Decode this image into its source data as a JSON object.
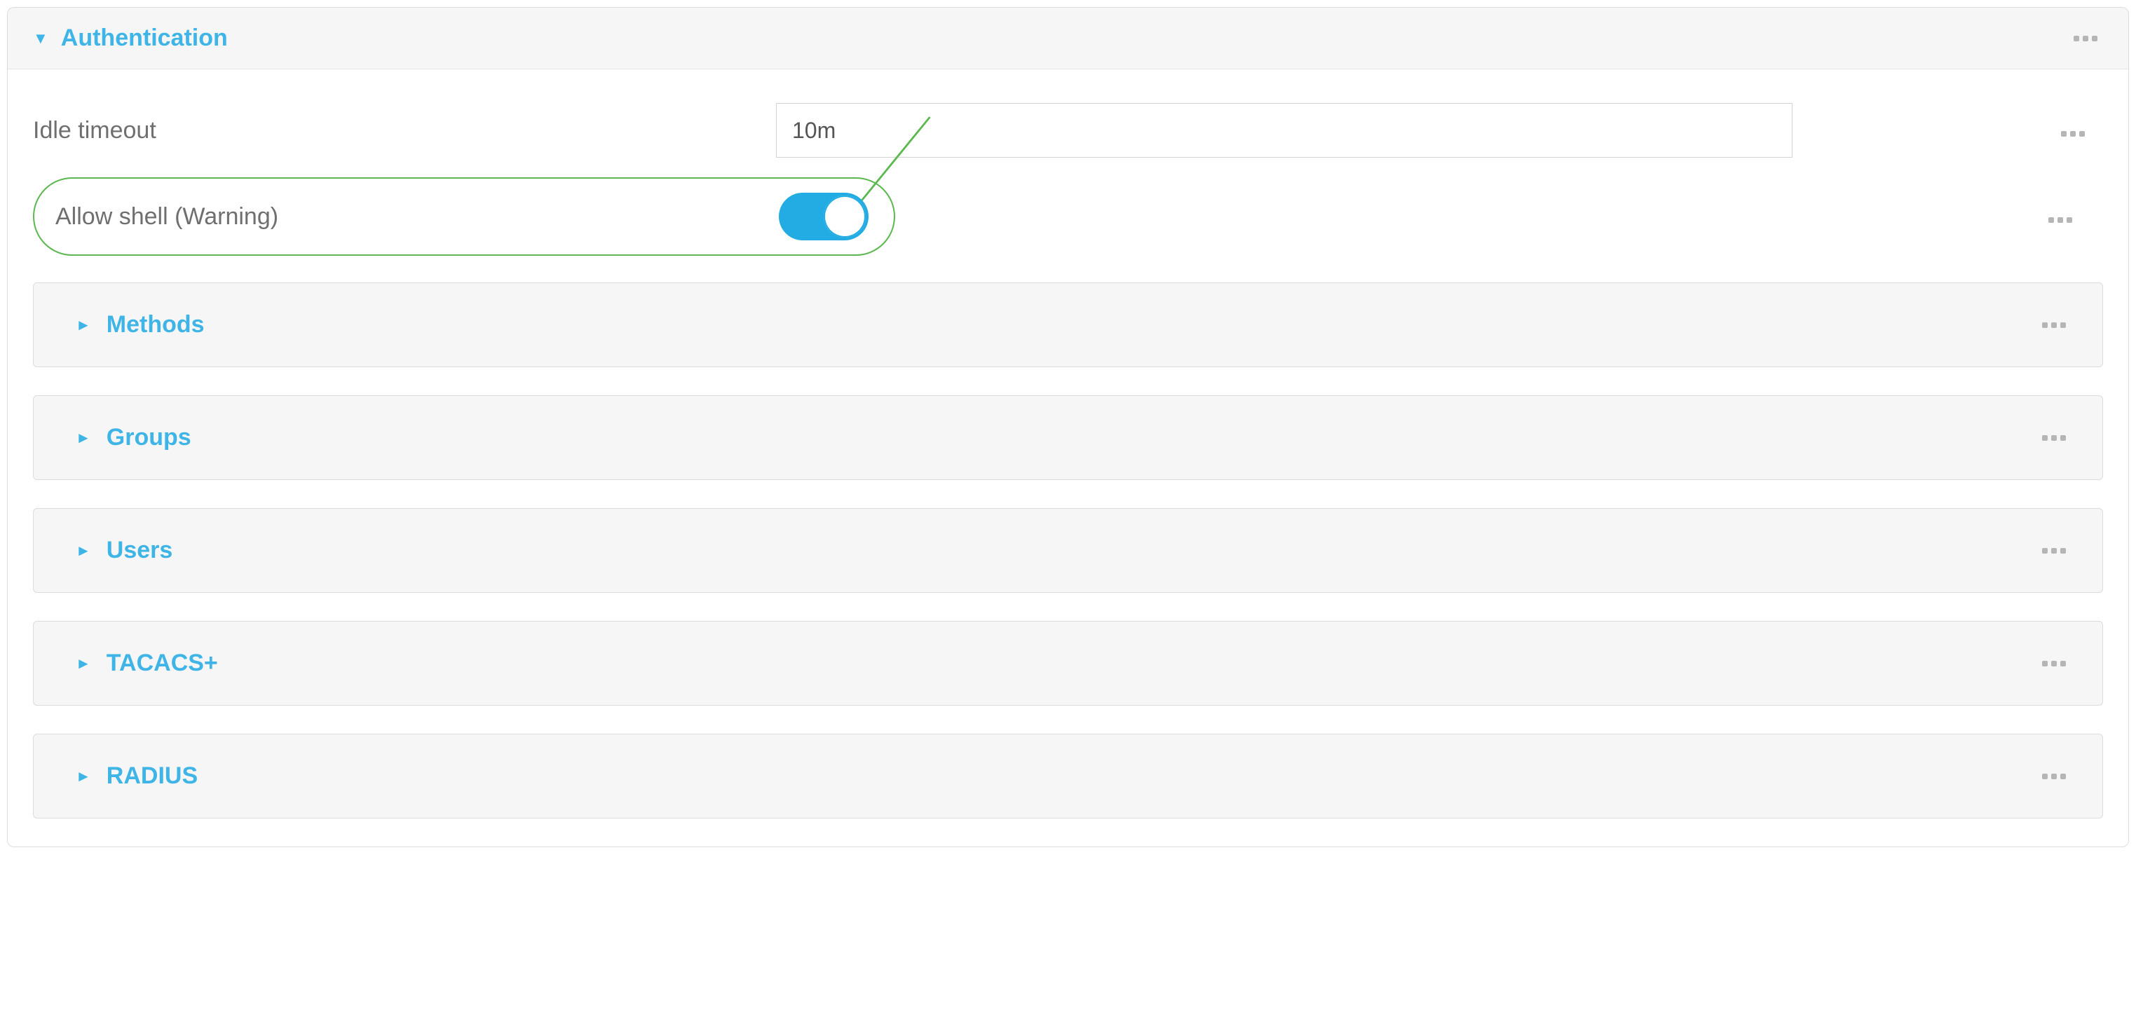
{
  "main_panel": {
    "title": "Authentication",
    "expanded": true
  },
  "idle_timeout": {
    "label": "Idle timeout",
    "value": "10m"
  },
  "allow_shell": {
    "label": "Allow shell (Warning)",
    "enabled": true
  },
  "sub_panels": [
    {
      "title": "Methods"
    },
    {
      "title": "Groups"
    },
    {
      "title": "Users"
    },
    {
      "title": "TACACS+"
    },
    {
      "title": "RADIUS"
    }
  ],
  "colors": {
    "accent": "#3fb4e6",
    "highlight_border": "#5bb84e"
  }
}
